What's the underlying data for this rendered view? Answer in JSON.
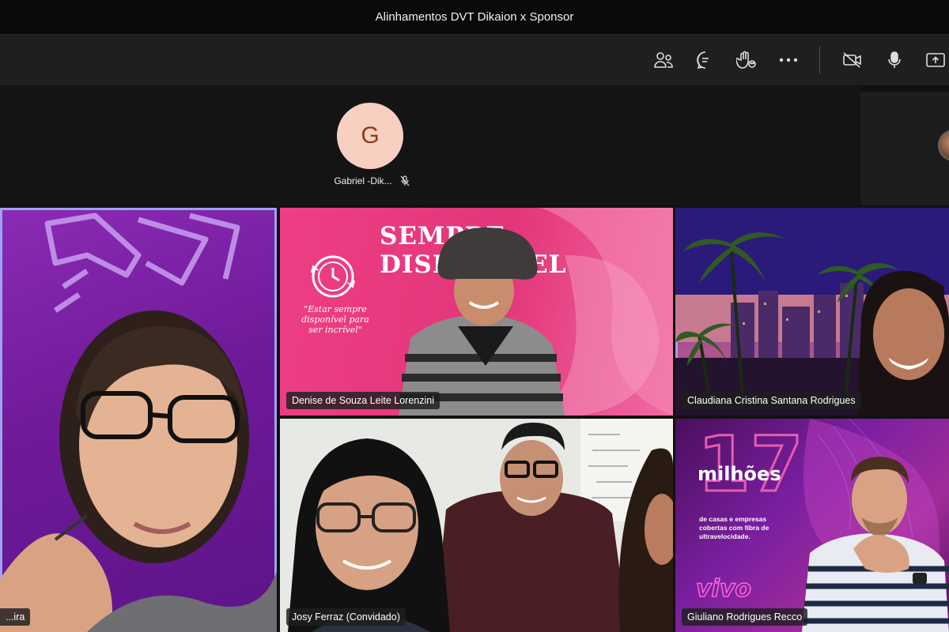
{
  "window": {
    "title": "Alinhamentos DVT Dikaion x Sponsor"
  },
  "toolbar": {
    "buttons": [
      {
        "name": "participants",
        "icon": "people-icon"
      },
      {
        "name": "chat",
        "icon": "chat-icon"
      },
      {
        "name": "reactions",
        "icon": "raise-hand-icon"
      },
      {
        "name": "more",
        "icon": "more-icon"
      },
      {
        "name": "camera",
        "icon": "camera-off-icon"
      },
      {
        "name": "mic",
        "icon": "mic-icon"
      },
      {
        "name": "share",
        "icon": "share-icon"
      }
    ]
  },
  "top_participant": {
    "initial": "G",
    "name": "Gabriel -Dik...",
    "muted": true
  },
  "tiles": [
    {
      "name": "...ira",
      "active": true
    },
    {
      "name": "Denise de Souza Leite Lorenzini",
      "active": false,
      "background_text": {
        "headline": "SEMPRE DISPONÍVEL",
        "quote": "\"Estar sempre disponível para ser incrível\""
      }
    },
    {
      "name": "Claudiana Cristina Santana Rodrigues",
      "active": true
    },
    {
      "name": "Josy Ferraz (Convidado)",
      "active": false
    },
    {
      "name": "Giuliano Rodrigues Recco",
      "active": false,
      "background_text": {
        "number": "17",
        "unit": "milhões",
        "caption": "de casas e empresas cobertas com fibra de ultravelocidade.",
        "brand": "vivo"
      }
    }
  ],
  "colors": {
    "accent": "#9ea2f3",
    "avatar_bg": "#f7d0c2",
    "avatar_fg": "#8a3a1a",
    "pink": "#e3357a",
    "purple": "#7a1fa0"
  }
}
